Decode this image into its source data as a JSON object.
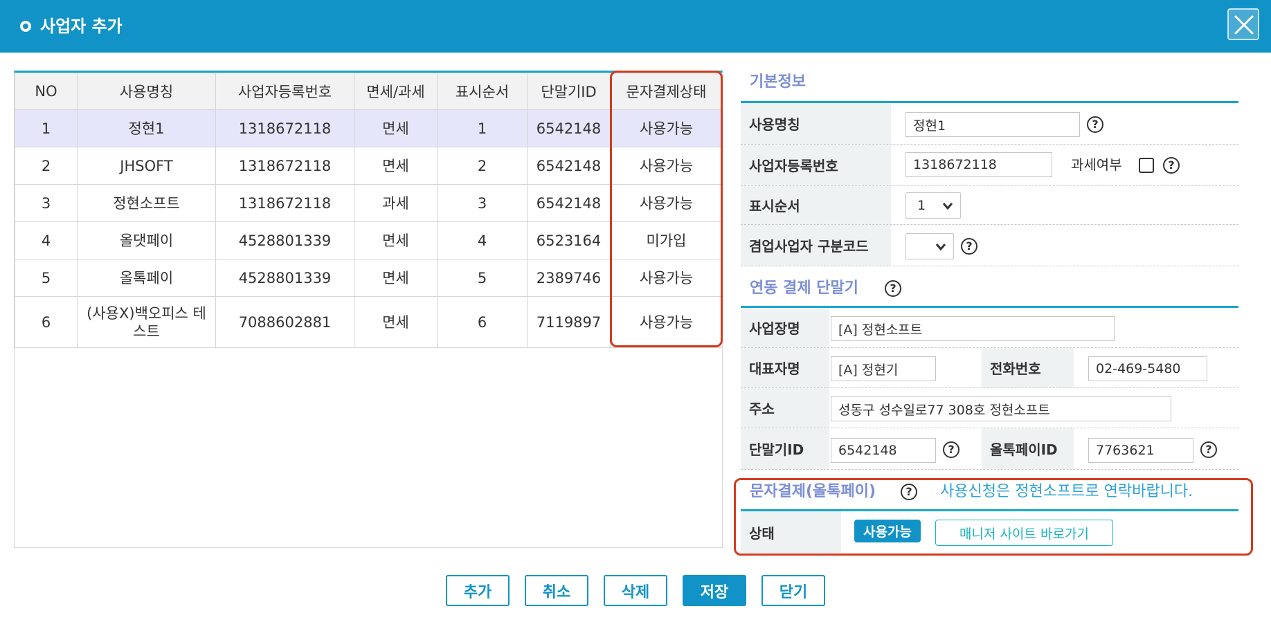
{
  "title": "사업자 추가",
  "colors": {
    "accent": "#1193c8",
    "highlight": "#d23b1e",
    "section": "#7b8fd6"
  },
  "table": {
    "headers": [
      "NO",
      "사용명칭",
      "사업자등록번호",
      "면세/과세",
      "표시순서",
      "단말기ID",
      "문자결제상태"
    ],
    "rows": [
      [
        "1",
        "정현1",
        "1318672118",
        "면세",
        "1",
        "6542148",
        "사용가능"
      ],
      [
        "2",
        "JHSOFT",
        "1318672118",
        "면세",
        "2",
        "6542148",
        "사용가능"
      ],
      [
        "3",
        "정현소프트",
        "1318672118",
        "과세",
        "3",
        "6542148",
        "사용가능"
      ],
      [
        "4",
        "올댓페이",
        "4528801339",
        "면세",
        "4",
        "6523164",
        "미가입"
      ],
      [
        "5",
        "올톡페이",
        "4528801339",
        "면세",
        "5",
        "2389746",
        "사용가능"
      ],
      [
        "6",
        "(사용X)백오피스 테스트",
        "7088602881",
        "면세",
        "6",
        "7119897",
        "사용가능"
      ]
    ]
  },
  "basic": {
    "section_title": "기본정보",
    "name_label": "사용명칭",
    "name_value": "정현1",
    "biz_no_label": "사업자등록번호",
    "biz_no_value": "1318672118",
    "tax_label": "과세여부",
    "order_label": "표시순서",
    "order_value": "1",
    "dual_label": "겸업사업자 구분코드",
    "dual_value": ""
  },
  "terminal": {
    "section_title": "연동 결제 단말기",
    "store_label": "사업장명",
    "store_value": "[A] 정현소프트",
    "ceo_label": "대표자명",
    "ceo_value": "[A] 정현기",
    "phone_label": "전화번호",
    "phone_value": "02-469-5480",
    "addr_label": "주소",
    "addr_value": "성동구 성수일로77 308호 정현소프트",
    "tid_label": "단말기ID",
    "tid_value": "6542148",
    "alltalk_label": "올톡페이ID",
    "alltalk_value": "7763621"
  },
  "sms": {
    "section_title": "문자결제(올톡페이)",
    "notice": "사용신청은 정현소프트로 연락바랍니다.",
    "status_label": "상태",
    "status_value": "사용가능",
    "manager_link": "매니저 사이트 바로가기"
  },
  "buttons": {
    "add": "추가",
    "cancel": "취소",
    "delete": "삭제",
    "save": "저장",
    "close": "닫기"
  },
  "help_glyph": "?"
}
